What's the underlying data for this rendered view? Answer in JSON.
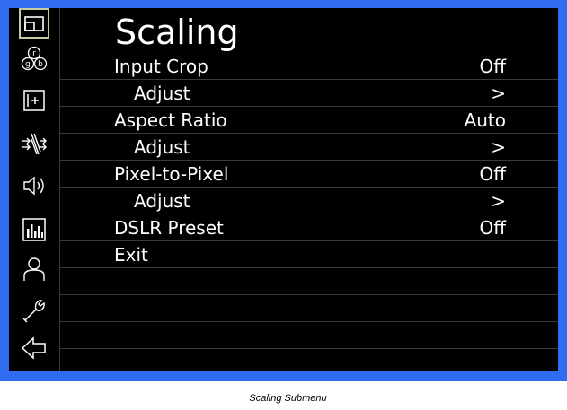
{
  "menu": {
    "title": "Scaling",
    "items": [
      {
        "label": "Input Crop",
        "value": "Off"
      },
      {
        "label": "Adjust",
        "value": ">"
      },
      {
        "label": "Aspect Ratio",
        "value": "Auto"
      },
      {
        "label": "Adjust",
        "value": ">"
      },
      {
        "label": "Pixel-to-Pixel",
        "value": "Off"
      },
      {
        "label": "Adjust",
        "value": ">"
      },
      {
        "label": "DSLR Preset",
        "value": "Off"
      },
      {
        "label": "Exit",
        "value": ""
      }
    ]
  },
  "sidebar": {
    "icons": [
      "scaling-icon",
      "color-rgb-icon",
      "overlay-icon",
      "input-routing-icon",
      "audio-icon",
      "meters-icon",
      "user-icon",
      "tools-icon",
      "back-arrow-icon"
    ],
    "rgb_letters": [
      "r",
      "g",
      "b"
    ]
  },
  "caption": "Scaling Submenu",
  "colors": {
    "frame": "#2f6cf0",
    "screen": "#000000",
    "text": "#ffffff",
    "divider": "#3a3a3a",
    "active_outline": "#c9c9a0"
  }
}
